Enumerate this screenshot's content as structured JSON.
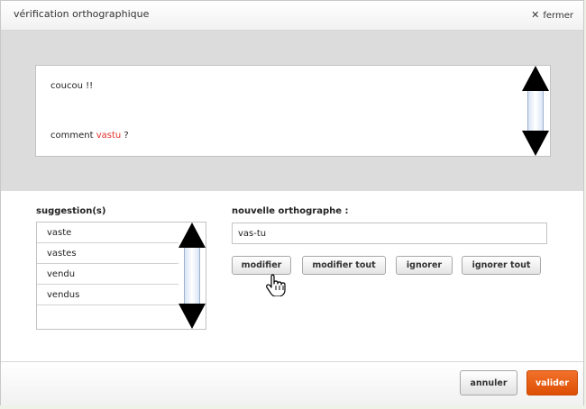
{
  "dialog": {
    "title": "vérification orthographique",
    "close_icon": "close-x-icon",
    "close_label": "fermer"
  },
  "text": {
    "line1": "coucou !!",
    "line2_before": "comment ",
    "misspelled_word": "vastu",
    "line2_after": " ?",
    "misspelled_color": "#e0312b"
  },
  "suggestions": {
    "label": "suggestion(s)",
    "items": [
      "vaste",
      "vastes",
      "vendu",
      "vendus"
    ]
  },
  "correction": {
    "label": "nouvelle orthographe :",
    "value": "vas-tu"
  },
  "actions": {
    "modify": "modifier",
    "modify_all": "modifier tout",
    "ignore": "ignorer",
    "ignore_all": "ignorer tout"
  },
  "footer": {
    "cancel": "annuler",
    "ok": "valider",
    "ok_color": "#e8601a"
  },
  "cursor_icon": "hand-pointer-icon"
}
